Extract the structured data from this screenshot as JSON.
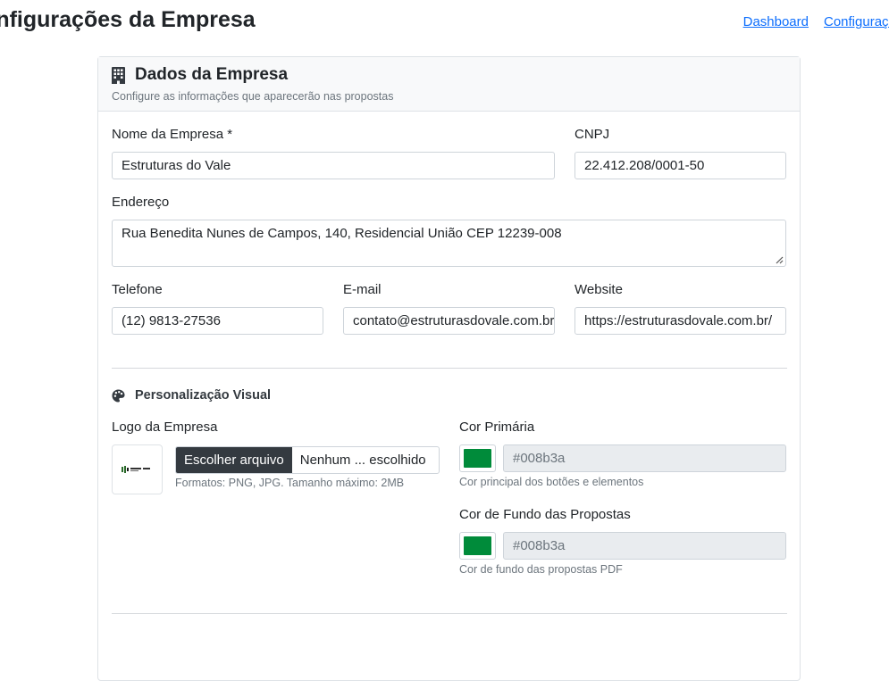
{
  "header": {
    "title": "Configurações da Empresa",
    "breadcrumb": [
      "Dashboard",
      "Configurações"
    ]
  },
  "card": {
    "title": "Dados da Empresa",
    "subtitle": "Configure as informações que aparecerão nas propostas",
    "icon": "building-icon"
  },
  "form": {
    "nome_label": "Nome da Empresa *",
    "nome_value": "Estruturas do Vale",
    "cnpj_label": "CNPJ",
    "cnpj_value": "22.412.208/0001-50",
    "endereco_label": "Endereço",
    "endereco_value": "Rua Benedita Nunes de Campos, 140, Residencial União CEP 12239-008",
    "telefone_label": "Telefone",
    "telefone_value": "(12) 9813-27536",
    "email_label": "E-mail",
    "email_value": "contato@estruturasdovale.com.br",
    "website_label": "Website",
    "website_value": "https://estruturasdovale.com.br/"
  },
  "visual": {
    "section_title": "Personalização Visual",
    "section_icon": "palette-icon",
    "logo_label": "Logo da Empresa",
    "file_button": "Escolher arquivo",
    "file_name": "Nenhum ... escolhido",
    "logo_help": "Formatos: PNG, JPG. Tamanho máximo: 2MB",
    "primary_label": "Cor Primária",
    "primary_value": "#008b3a",
    "primary_help": "Cor principal dos botões e elementos",
    "bg_label": "Cor de Fundo das Propostas",
    "bg_value": "#008b3a",
    "bg_help": "Cor de fundo das propostas PDF"
  },
  "colors": {
    "link": "#0d6efd",
    "primary_swatch": "#008b3a",
    "bg_swatch": "#008b3a",
    "file_button_bg": "#343a40"
  }
}
